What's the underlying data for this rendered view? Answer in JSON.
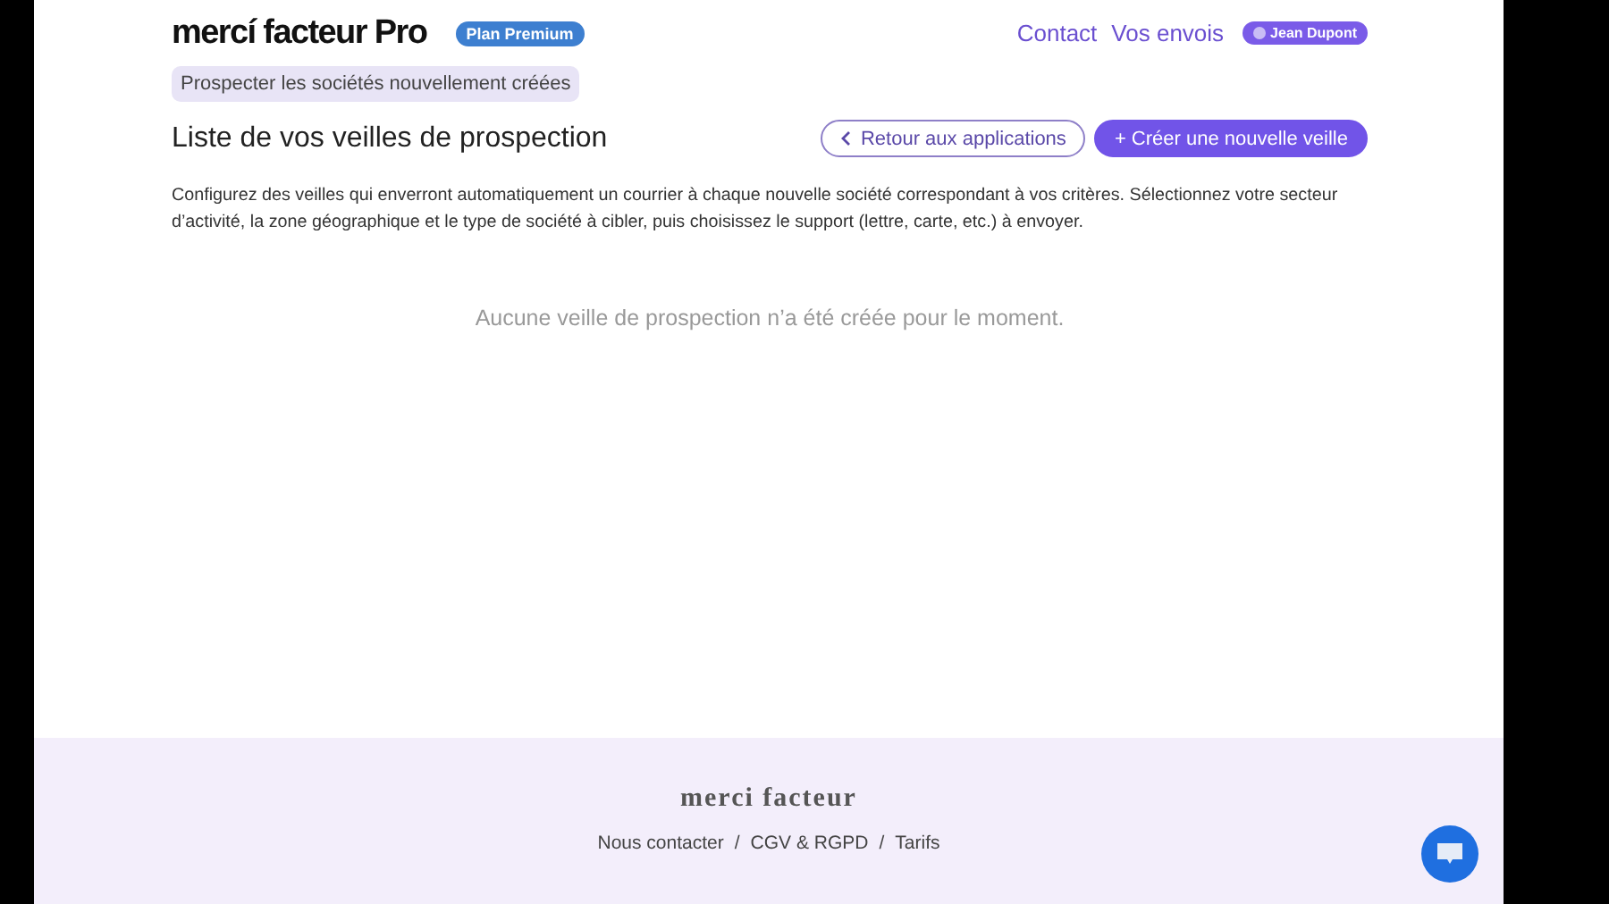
{
  "header": {
    "logo": "mercí facteur Pro",
    "plan_badge": "Plan Premium",
    "nav": [
      "Contact",
      "Vos envois"
    ],
    "user": "Jean Dupont"
  },
  "breadcrumb": "Prospecter les sociétés nouvellement créées",
  "title": "Liste de vos veilles de prospection",
  "buttons": [
    {
      "label": "Retour aux applications",
      "kind": "back"
    },
    {
      "label": "+ Créer une nouvelle veille",
      "kind": "primary"
    }
  ],
  "description": "Configurez des veilles qui enverront automatiquement un courrier à chaque nouvelle société correspondant à vos critères. Sélectionnez votre secteur d’activité, la zone géographique et le type de société à cibler, puis choisissez le support (lettre, carte, etc.) à envoyer.",
  "empty_message": "Aucune veille de prospection n’a été créée pour le moment.",
  "footer": {
    "brand": "merci facteur",
    "links": [
      "Nous contacter",
      "CGV & RGPD",
      "Tarifs"
    ],
    "separator": "/"
  }
}
